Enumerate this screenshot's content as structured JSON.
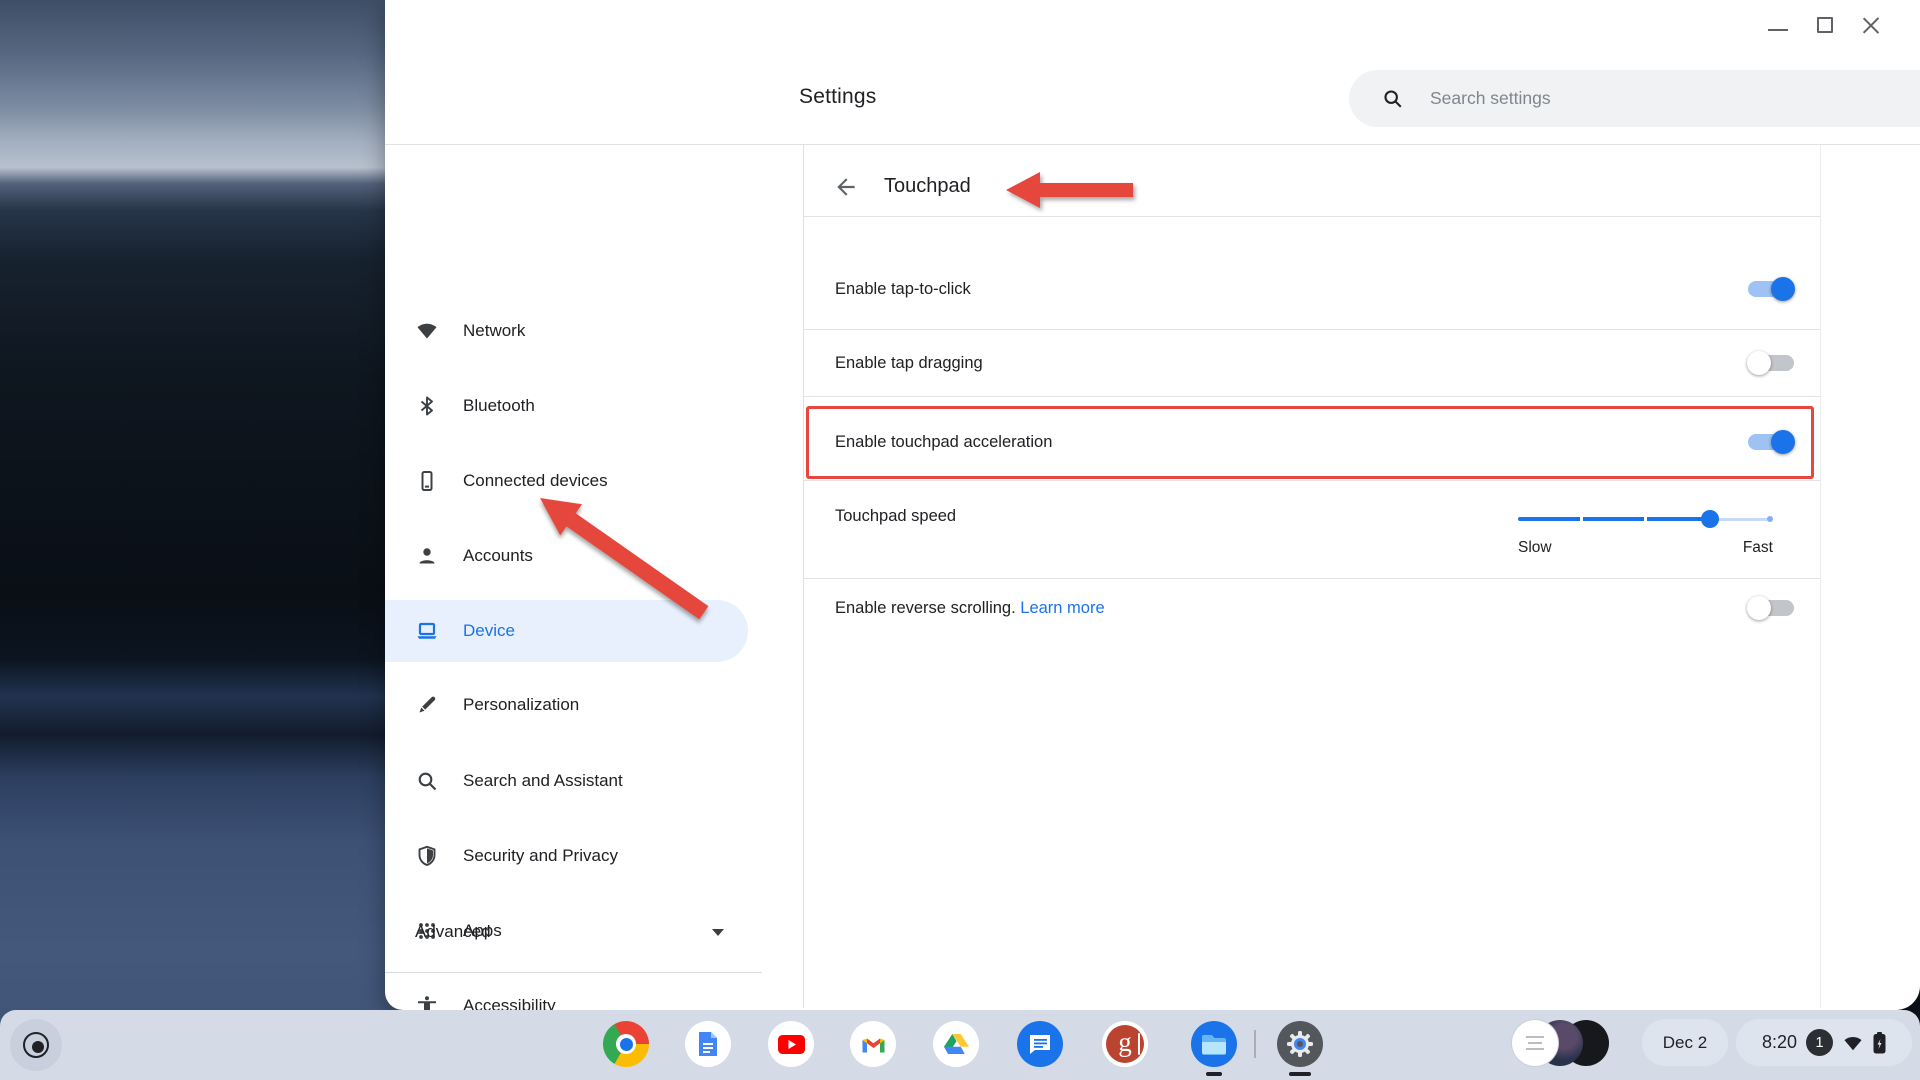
{
  "window": {
    "title": "Settings",
    "search": {
      "placeholder": "Search settings"
    },
    "controls": [
      "minimize",
      "maximize",
      "close"
    ]
  },
  "sidebar": {
    "items": [
      {
        "label": "Network",
        "icon": "wifi-icon",
        "selected": false
      },
      {
        "label": "Bluetooth",
        "icon": "bluetooth-icon",
        "selected": false
      },
      {
        "label": "Connected devices",
        "icon": "smartphone-icon",
        "selected": false
      },
      {
        "label": "Accounts",
        "icon": "person-icon",
        "selected": false
      },
      {
        "label": "Device",
        "icon": "laptop-icon",
        "selected": true
      },
      {
        "label": "Personalization",
        "icon": "pen-icon",
        "selected": false
      },
      {
        "label": "Search and Assistant",
        "icon": "magnifier-icon",
        "selected": false
      },
      {
        "label": "Security and Privacy",
        "icon": "shield-icon",
        "selected": false
      },
      {
        "label": "Apps",
        "icon": "apps-grid-icon",
        "selected": false
      },
      {
        "label": "Accessibility",
        "icon": "accessibility-icon",
        "selected": false
      }
    ],
    "advanced_label": "Advanced"
  },
  "content": {
    "page_title": "Touchpad",
    "rows": [
      {
        "label": "Enable tap-to-click",
        "control": "toggle",
        "state": "on"
      },
      {
        "label": "Enable tap dragging",
        "control": "toggle",
        "state": "off"
      },
      {
        "label": "Enable touchpad acceleration",
        "control": "toggle",
        "state": "on",
        "highlighted": true
      },
      {
        "label": "Touchpad speed",
        "control": "slider",
        "slider": {
          "min_label": "Slow",
          "max_label": "Fast",
          "value_percent": 76
        }
      },
      {
        "label": "Enable reverse scrolling.",
        "link_label": "Learn more",
        "control": "toggle",
        "state": "off"
      }
    ]
  },
  "annotations": {
    "color": "#e5473c",
    "highlighted_row": "Enable touchpad acceleration",
    "arrow_targets": [
      "Touchpad",
      "Device"
    ]
  },
  "shelf": {
    "apps": [
      "chrome",
      "docs",
      "youtube",
      "gmail",
      "drive",
      "messages",
      "google-g",
      "files",
      "settings"
    ],
    "google_g_glyph": "g",
    "running_apps": [
      "files",
      "settings"
    ],
    "status": {
      "date": "Dec 2",
      "time": "8:20",
      "notification_count": "1"
    }
  },
  "colors": {
    "accent": "#1a73e8",
    "selected_bg": "#e8f0fe",
    "annotation_red": "#e5473c",
    "shelf_bg": "#d4dbe6"
  }
}
